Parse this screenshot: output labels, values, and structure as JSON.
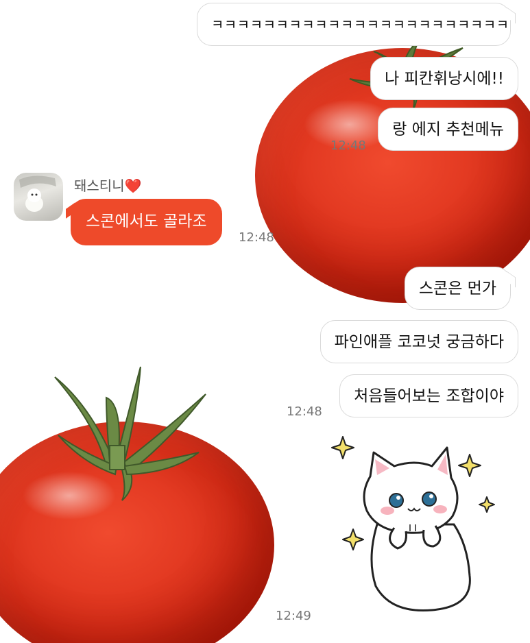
{
  "messages": {
    "m1": "ㅋㅋㅋㅋㅋㅋㅋㅋㅋㅋㅋㅋㅋㅋㅋㅋㅋㅋㅋㅋㅋㅋㅋ",
    "m2": "나 피칸휘낭시에!!",
    "m3": "랑 에지 추천메뉴",
    "time1": "12:48",
    "m4": "스콘에서도 골라조",
    "time2": "12:48",
    "m5": "스콘은 먼가",
    "m6": "파인애플 코코넛 궁금하다",
    "m7": "처음들어보는 조합이야",
    "time3": "12:48",
    "time4": "12:49"
  },
  "sender": {
    "name": "돼스티니",
    "heart": "❤️"
  },
  "colors": {
    "their_bubble": "#ee4a2a",
    "my_bubble": "#ffffff",
    "timestamp": "#777777"
  },
  "media": {
    "tomato_icon": "tomato-photo",
    "sticker_icon": "white-cat-sticker"
  }
}
